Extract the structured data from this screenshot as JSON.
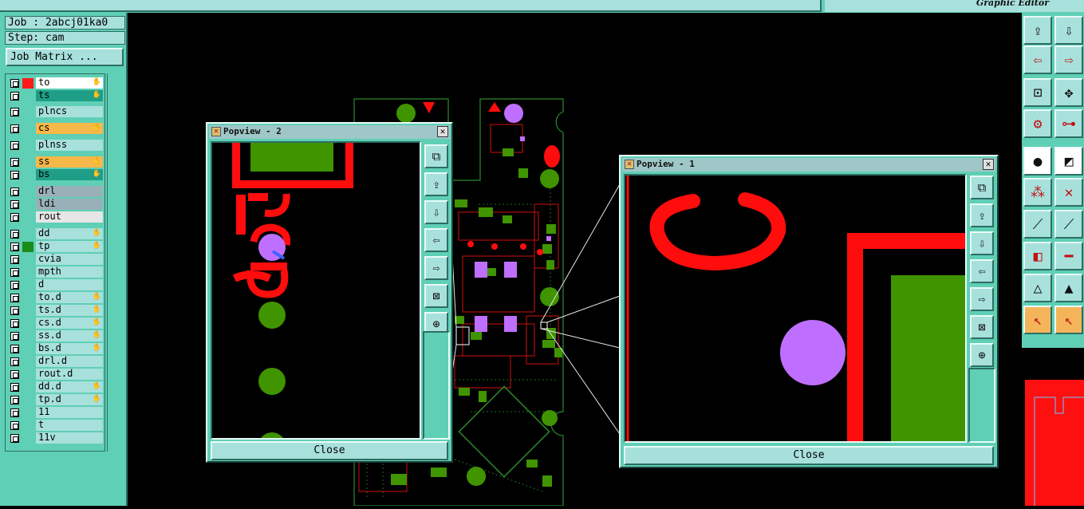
{
  "app": {
    "title": "Graphic Editor"
  },
  "job": {
    "job_text": "Job : 2abcj01ka0",
    "step_text": "Step: cam",
    "job_matrix_label": "Job Matrix ..."
  },
  "layers": [
    {
      "name": "to",
      "color": "#ff1a1a",
      "bg": "#ffffff",
      "hand": true
    },
    {
      "name": "ts",
      "color": "",
      "bg": "#1e9e86",
      "hand": true
    },
    {
      "name": "plncs",
      "color": "",
      "bg": "#a8e0dc",
      "hand": false
    },
    {
      "name": "cs",
      "color": "",
      "bg": "#f7b84a",
      "hand": true
    },
    {
      "name": "plnss",
      "color": "",
      "bg": "#a8e0dc",
      "hand": false
    },
    {
      "name": "ss",
      "color": "",
      "bg": "#f7b84a",
      "hand": true
    },
    {
      "name": "bs",
      "color": "",
      "bg": "#1e9e86",
      "hand": true
    },
    {
      "name": "drl",
      "color": "",
      "bg": "#9ab0b8",
      "hand": false
    },
    {
      "name": "ldi",
      "color": "",
      "bg": "#9ab0b8",
      "hand": false
    },
    {
      "name": "rout",
      "color": "",
      "bg": "#e6e6e6",
      "hand": false
    },
    {
      "name": "dd",
      "color": "",
      "bg": "#a8e0dc",
      "hand": true
    },
    {
      "name": "tp",
      "color": "#1a8c1a",
      "bg": "#a8e0dc",
      "hand": true
    },
    {
      "name": "cvia",
      "color": "",
      "bg": "#a8e0dc",
      "hand": false
    },
    {
      "name": "mpth",
      "color": "",
      "bg": "#a8e0dc",
      "hand": false
    },
    {
      "name": "d",
      "color": "",
      "bg": "#a8e0dc",
      "hand": false
    },
    {
      "name": "to.d",
      "color": "",
      "bg": "#a8e0dc",
      "hand": true
    },
    {
      "name": "ts.d",
      "color": "",
      "bg": "#a8e0dc",
      "hand": true
    },
    {
      "name": "cs.d",
      "color": "",
      "bg": "#a8e0dc",
      "hand": true
    },
    {
      "name": "ss.d",
      "color": "",
      "bg": "#a8e0dc",
      "hand": true
    },
    {
      "name": "bs.d",
      "color": "",
      "bg": "#a8e0dc",
      "hand": true
    },
    {
      "name": "drl.d",
      "color": "",
      "bg": "#a8e0dc",
      "hand": false
    },
    {
      "name": "rout.d",
      "color": "",
      "bg": "#a8e0dc",
      "hand": false
    },
    {
      "name": "dd.d",
      "color": "",
      "bg": "#a8e0dc",
      "hand": true
    },
    {
      "name": "tp.d",
      "color": "",
      "bg": "#a8e0dc",
      "hand": true
    },
    {
      "name": "11",
      "color": "",
      "bg": "#a8e0dc",
      "hand": false
    },
    {
      "name": "t",
      "color": "",
      "bg": "#a8e0dc",
      "hand": false
    },
    {
      "name": "11v",
      "color": "",
      "bg": "#a8e0dc",
      "hand": false
    }
  ],
  "popview1": {
    "title": "Popview - 1",
    "close_label": "Close",
    "close_glyph": "✕"
  },
  "popview2": {
    "title": "Popview - 2",
    "close_label": "Close",
    "close_glyph": "✕"
  },
  "colors": {
    "panel": "#5fcfb5",
    "pale": "#a8e0dc",
    "copper": "#ff0d0d",
    "pad_green": "#3f9400",
    "via_purple": "#bf6fff"
  }
}
